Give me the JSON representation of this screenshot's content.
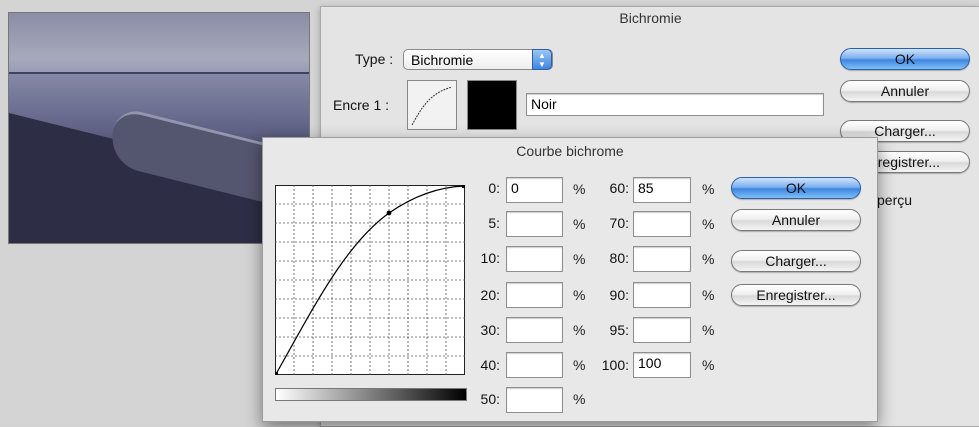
{
  "back_dialog": {
    "title": "Bichromie",
    "type_label": "Type :",
    "type_value": "Bichromie",
    "ink1_label": "Encre 1 :",
    "ink1_name": "Noir",
    "ink1_color": "#000000",
    "buttons": {
      "ok": "OK",
      "cancel": "Annuler",
      "load": "Charger...",
      "save": "nregistrer..."
    },
    "preview_label": "perçu"
  },
  "curve_dialog": {
    "title": "Courbe bichrome",
    "percent_sign": "%",
    "fields": [
      {
        "label": "0:",
        "value": "0"
      },
      {
        "label": "5:",
        "value": ""
      },
      {
        "label": "10:",
        "value": ""
      },
      {
        "label": "20:",
        "value": ""
      },
      {
        "label": "30:",
        "value": ""
      },
      {
        "label": "40:",
        "value": ""
      },
      {
        "label": "50:",
        "value": ""
      },
      {
        "label": "60:",
        "value": "85"
      },
      {
        "label": "70:",
        "value": ""
      },
      {
        "label": "80:",
        "value": ""
      },
      {
        "label": "90:",
        "value": ""
      },
      {
        "label": "95:",
        "value": ""
      },
      {
        "label": "100:",
        "value": "100"
      }
    ],
    "buttons": {
      "ok": "OK",
      "cancel": "Annuler",
      "load": "Charger...",
      "save": "Enregistrer..."
    }
  },
  "accent_color": "#3f86e0"
}
